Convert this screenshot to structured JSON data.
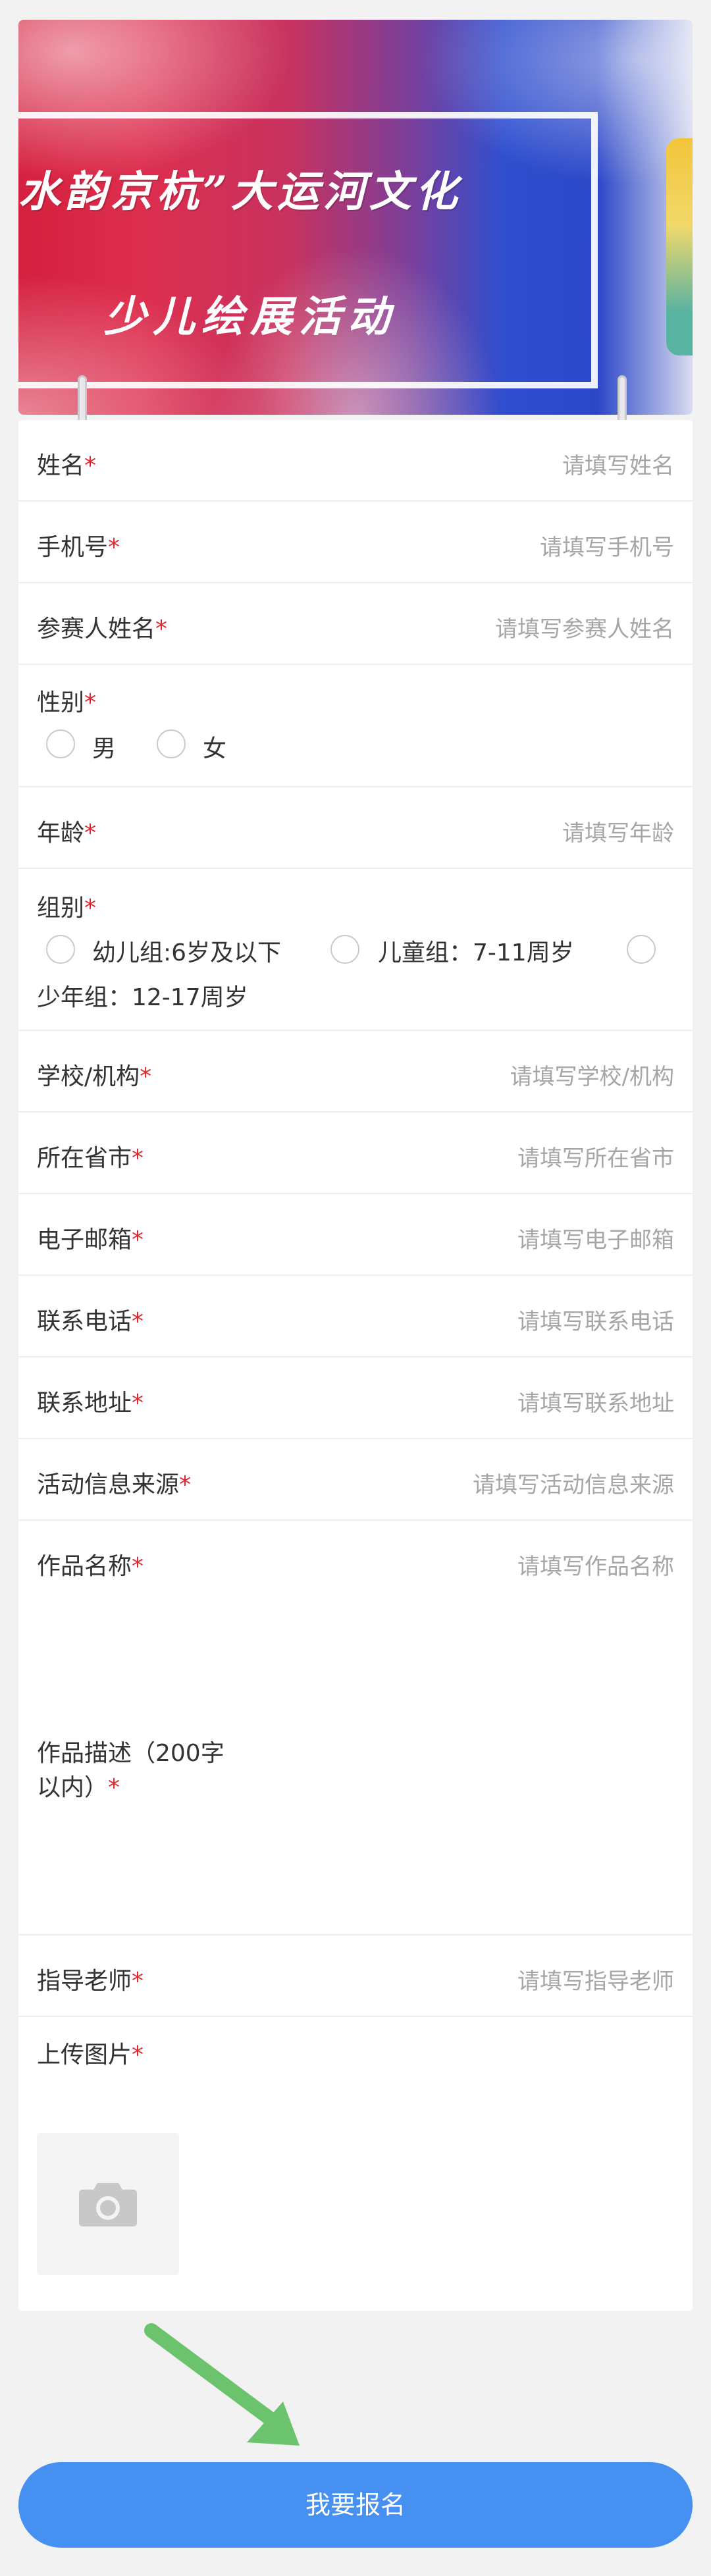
{
  "banner": {
    "title": "水韵京杭”大运河文化",
    "subtitle": "少儿绘展活动"
  },
  "form": {
    "required_mark": "*",
    "fields": {
      "name": {
        "label": "姓名",
        "placeholder": "请填写姓名"
      },
      "phone": {
        "label": "手机号",
        "placeholder": "请填写手机号"
      },
      "participant_name": {
        "label": "参赛人姓名",
        "placeholder": "请填写参赛人姓名"
      },
      "gender": {
        "label": "性别",
        "options": [
          "男",
          "女"
        ]
      },
      "age": {
        "label": "年龄",
        "placeholder": "请填写年龄"
      },
      "group": {
        "label": "组别",
        "options": [
          "幼儿组:6岁及以下",
          "儿童组：7-11周岁",
          "少年组：12-17周岁"
        ]
      },
      "school": {
        "label": "学校/机构",
        "placeholder": "请填写学校/机构"
      },
      "province_city": {
        "label": "所在省市",
        "placeholder": "请填写所在省市"
      },
      "email": {
        "label": "电子邮箱",
        "placeholder": "请填写电子邮箱"
      },
      "contact_phone": {
        "label": "联系电话",
        "placeholder": "请填写联系电话"
      },
      "address": {
        "label": "联系地址",
        "placeholder": "请填写联系地址"
      },
      "info_source": {
        "label": "活动信息来源",
        "placeholder": "请填写活动信息来源"
      },
      "work_title": {
        "label": "作品名称",
        "placeholder": "请填写作品名称"
      },
      "work_desc": {
        "label_line1": "作品描述（200字",
        "label_line2": "以内）"
      },
      "teacher": {
        "label": "指导老师",
        "placeholder": "请填写指导老师"
      },
      "upload": {
        "label": "上传图片",
        "icon": "camera-icon"
      }
    }
  },
  "submit": {
    "label": "我要报名"
  },
  "colors": {
    "accent": "#4590f0",
    "required": "#e0282e",
    "arrow": "#6cc36e"
  }
}
